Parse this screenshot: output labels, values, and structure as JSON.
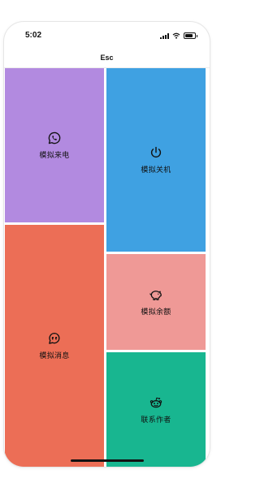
{
  "status_bar": {
    "time": "5:02",
    "icons": [
      "signal-icon",
      "wifi-icon",
      "battery-icon"
    ]
  },
  "nav": {
    "title": "Esc"
  },
  "tiles": [
    {
      "label": "模拟来电",
      "icon": "whatsapp-phone-icon",
      "color": "#b28ae0"
    },
    {
      "label": "模拟关机",
      "icon": "power-icon",
      "color": "#3fa1e2"
    },
    {
      "label": "模拟消息",
      "icon": "chat-quote-icon",
      "color": "#ec6e56"
    },
    {
      "label": "模拟余额",
      "icon": "piggy-bank-icon",
      "color": "#ef9996"
    },
    {
      "label": "联系作者",
      "icon": "reddit-icon",
      "color": "#18b690"
    }
  ]
}
